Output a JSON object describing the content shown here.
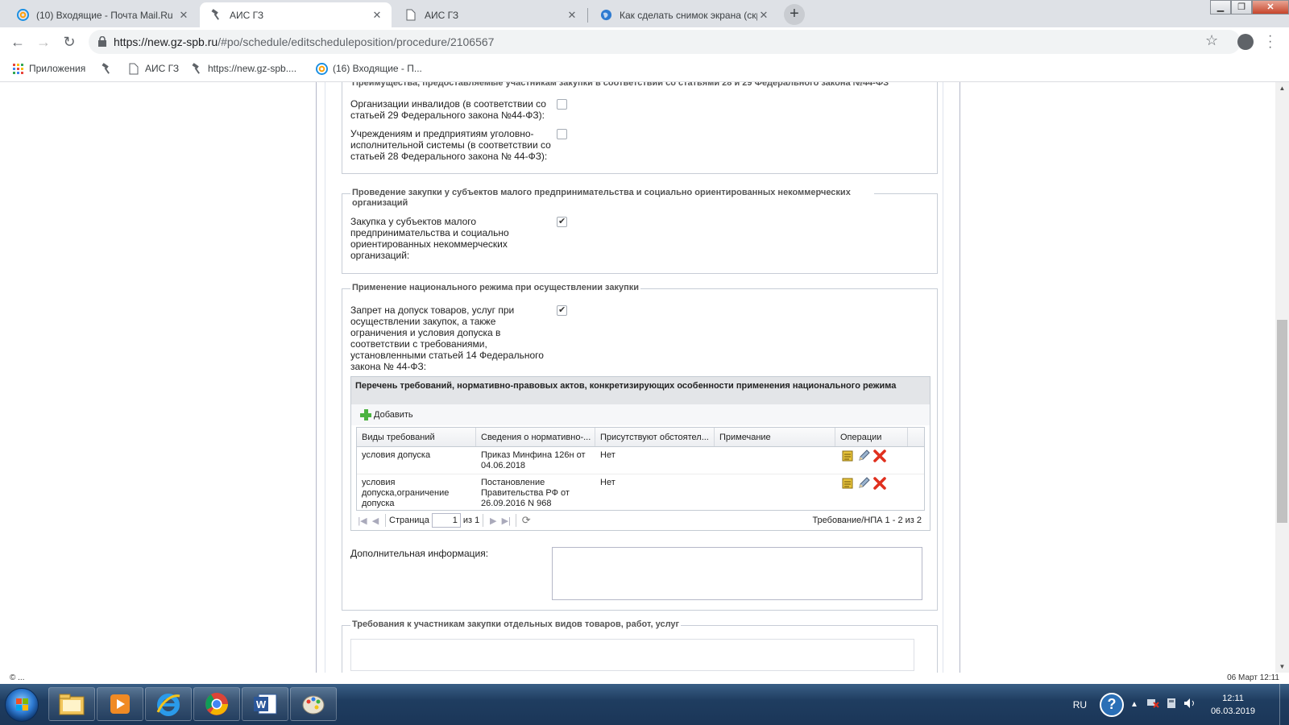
{
  "browser": {
    "tabs": [
      {
        "title": "(10) Входящие - Почта Mail.Ru",
        "icon": "mail-ru-icon",
        "active": false
      },
      {
        "title": "АИС ГЗ",
        "icon": "hammer-icon",
        "active": true
      },
      {
        "title": "АИС ГЗ",
        "icon": "page-icon",
        "active": false
      },
      {
        "title": "Как сделать снимок экрана (скр",
        "icon": "globe-icon",
        "active": false
      }
    ],
    "new_tab": "+",
    "url_host": "https://new.gz-spb.ru",
    "url_path": "/#po/schedule/editscheduleposition/procedure/2106567",
    "bookmarks": [
      {
        "label": "Приложения",
        "icon": "apps-grid-icon"
      },
      {
        "label": "",
        "icon": "hammer-icon"
      },
      {
        "label": "АИС ГЗ",
        "icon": "page-icon"
      },
      {
        "label": "https://new.gz-spb....",
        "icon": "hammer-icon"
      },
      {
        "label": "(16) Входящие - П...",
        "icon": "mail-ru-icon"
      }
    ]
  },
  "page": {
    "advantages": {
      "legend": "Преимущества, предоставляемые участникам закупки в соответствии со статьями 28 и 29 Федерального закона №44-ФЗ",
      "fields": [
        {
          "label": "Организации инвалидов (в соответствии со статьей 29 Федерального закона №44-ФЗ):",
          "checked": false
        },
        {
          "label": "Учреждениям и предприятиям уголовно-исполнительной системы (в соответствии со статьей 28 Федерального закона № 44-ФЗ):",
          "checked": false
        }
      ]
    },
    "smb": {
      "legend": "Проведение закупки у субъектов малого предпринимательства и социально ориентированных некоммерческих организаций",
      "field": {
        "label": "Закупка у субъектов малого предпринимательства и социально ориентированных некоммерческих организаций:",
        "checked": true
      }
    },
    "national": {
      "legend": "Применение национального режима при осуществлении закупки",
      "field": {
        "label": "Запрет на допуск товаров, услуг при осуществлении закупок, а также ограничения и условия допуска в соответствии с требованиями, установленными статьей 14 Федерального закона № 44-ФЗ:",
        "checked": true
      },
      "panel": {
        "title": "Перечень требований, нормативно-правовых актов, конкретизирующих особенности применения национального режима",
        "add_label": "Добавить",
        "columns": [
          "Виды требований",
          "Сведения о нормативно-...",
          "Присутствуют обстоятел...",
          "Примечание",
          "Операции"
        ],
        "rows": [
          {
            "type": "условия допуска",
            "info": "Приказ Минфина 126н от 04.06.2018",
            "present": "Нет",
            "note": ""
          },
          {
            "type": "условия допуска,ограничение допуска",
            "info": "Постановление Правительства РФ от 26.09.2016 N 968",
            "present": "Нет",
            "note": ""
          }
        ],
        "pager": {
          "page_label": "Страница",
          "page_value": "1",
          "of_label": "из 1",
          "summary": "Требование/НПА 1 - 2 из 2"
        }
      },
      "extra_label": "Дополнительная информация:",
      "extra_value": ""
    },
    "requirements": {
      "legend": "Требования к участникам закупки отдельных видов товаров, работ, услуг"
    }
  },
  "status": {
    "left": "© ...",
    "right": "06 Март 12:11"
  },
  "taskbar": {
    "apps": [
      "explorer-icon",
      "media-player-icon",
      "ie-icon",
      "chrome-icon",
      "word-icon",
      "paint-icon"
    ],
    "lang": "RU",
    "time": "12:11",
    "date": "06.03.2019"
  },
  "colors": {
    "chrome_tabstrip": "#dee1e6",
    "taskbar": "#1f3d60",
    "delete_red": "#e0301e",
    "add_green": "#4bb341"
  }
}
